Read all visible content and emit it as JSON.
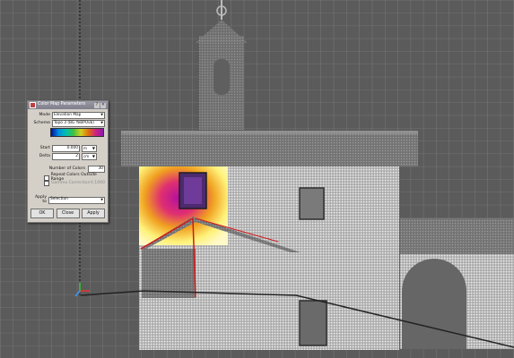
{
  "dialog": {
    "title": "Color Map Parameters",
    "mode_label": "Mode",
    "mode_value": "Elevation Map",
    "scheme_label": "Scheme",
    "scheme_value": "Topo 3 (BG YeBPUvb)",
    "start_label": "Start",
    "start_value": "0.000",
    "start_unit": "m",
    "delta_label": "Delta",
    "delta_value": "2",
    "delta_unit": "cm",
    "num_colors_label": "Number of Colors",
    "num_colors_value": "30",
    "repeat_label": "Repeat Colors Outside Range",
    "gamma_label": "Gamma Correction",
    "gamma_value": "0.1000",
    "apply_to_label": "Apply to",
    "apply_to_value": "Selection",
    "ok_label": "OK",
    "close_label": "Close",
    "apply_label": "Apply"
  },
  "colors": {
    "viewport_bg": "#5b5b5b",
    "grid": "#8a8a8a",
    "selection_outline": "#d11a1a"
  }
}
